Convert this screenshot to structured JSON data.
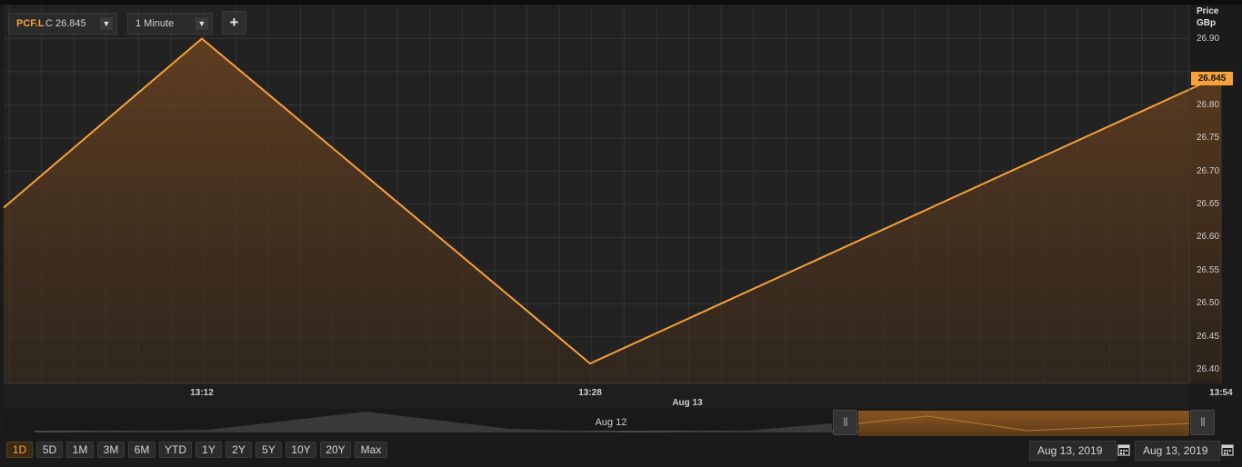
{
  "toolbar": {
    "symbol": "PCF.L",
    "quote": "C 26.845",
    "symbol_caret_icon": "caret-down-icon",
    "interval": "1 Minute",
    "interval_caret_icon": "caret-down-icon",
    "add_label": "+"
  },
  "axis": {
    "title_line1": "Price",
    "title_line2": "GBp",
    "y_ticks": [
      "26.90",
      "26.80",
      "26.75",
      "26.70",
      "26.65",
      "26.60",
      "26.55",
      "26.50",
      "26.45",
      "26.40"
    ],
    "last_price": "26.845",
    "x_ticks": [
      "13:12",
      "13:28",
      "13:54"
    ],
    "date_label": "Aug 13"
  },
  "navigator": {
    "date_label": "Aug 12",
    "left_handle": "|||",
    "right_handle": "|||"
  },
  "range_buttons": [
    "1D",
    "5D",
    "1M",
    "3M",
    "6M",
    "YTD",
    "1Y",
    "2Y",
    "5Y",
    "10Y",
    "20Y",
    "Max"
  ],
  "active_range": "1D",
  "date_range": {
    "start": "Aug 13, 2019",
    "end": "Aug 13, 2019",
    "calendar_icon": "calendar-icon"
  },
  "colors": {
    "line": "#f7a13b",
    "background": "#1b1b1b",
    "grid": "#343434",
    "last_price_badge": "#f7a13b"
  },
  "chart_data": {
    "type": "area",
    "x": [
      "13:04",
      "13:12",
      "13:28",
      "13:54"
    ],
    "y": [
      26.645,
      26.9,
      26.41,
      26.845
    ],
    "ylim": [
      26.38,
      26.95
    ],
    "ylabel": "Price GBp",
    "x_ticks": [
      "13:12",
      "13:28",
      "13:54"
    ],
    "last_value": 26.845,
    "grid": true
  }
}
